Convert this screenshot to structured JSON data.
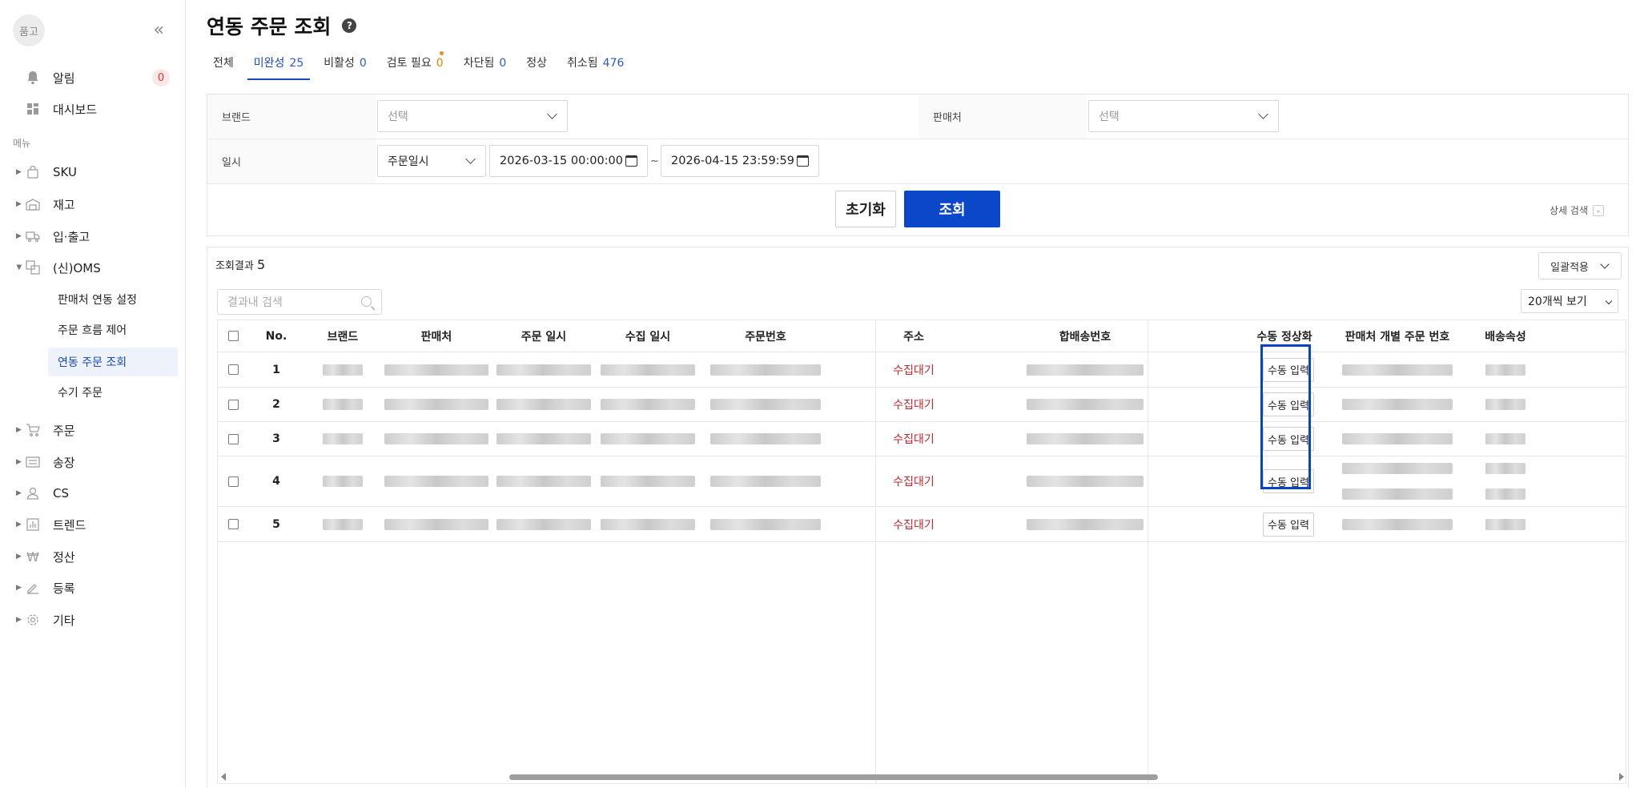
{
  "sidebar": {
    "avatar_text": "품고",
    "menu_label": "메뉴",
    "top_items": [
      {
        "label": "알림",
        "badge": "0"
      },
      {
        "label": "대시보드"
      }
    ],
    "items": [
      {
        "label": "SKU"
      },
      {
        "label": "재고"
      },
      {
        "label": "입·출고"
      },
      {
        "label": "(신)OMS"
      },
      {
        "label": "주문"
      },
      {
        "label": "송장"
      },
      {
        "label": "CS"
      },
      {
        "label": "트렌드"
      },
      {
        "label": "정산"
      },
      {
        "label": "등록"
      },
      {
        "label": "기타"
      }
    ],
    "oms_sub": [
      {
        "label": "판매처 연동 설정"
      },
      {
        "label": "주문 흐름 제어"
      },
      {
        "label": "연동 주문 조회"
      },
      {
        "label": "수기 주문"
      }
    ]
  },
  "page": {
    "title": "연동 주문 조회",
    "help": "?"
  },
  "tabs": [
    {
      "label": "전체",
      "count": ""
    },
    {
      "label": "미완성",
      "count": "25"
    },
    {
      "label": "비활성",
      "count": "0"
    },
    {
      "label": "검토 필요",
      "count": "0"
    },
    {
      "label": "차단됨",
      "count": "0"
    },
    {
      "label": "정상",
      "count": ""
    },
    {
      "label": "취소됨",
      "count": "476"
    }
  ],
  "filter": {
    "brand_label": "브랜드",
    "brand_value": "선택",
    "seller_label": "판매처",
    "seller_value": "선택",
    "date_label": "일시",
    "date_type": "주문일시",
    "date_from": "2026-03-15 00:00:00",
    "date_sep": "~",
    "date_to": "2026-04-15 23:59:59",
    "reset": "초기화",
    "search": "조회",
    "advanced": "상세 검색"
  },
  "results": {
    "title": "조회결과",
    "count": "5",
    "bulk": "일괄적용",
    "search_placeholder": "결과내 검색",
    "page_size": "20개씩 보기",
    "columns": [
      "No.",
      "브랜드",
      "판매처",
      "주문 일시",
      "수집 일시",
      "주문번호",
      "주소",
      "합배송번호",
      "수동 정상화",
      "판매처 개별 주문 번호",
      "배송속성"
    ],
    "rows": [
      {
        "no": "1",
        "address": "수집대기",
        "action": "수동 입력"
      },
      {
        "no": "2",
        "address": "수집대기",
        "action": "수동 입력"
      },
      {
        "no": "3",
        "address": "수집대기",
        "action": "수동 입력"
      },
      {
        "no": "4",
        "address": "수집대기",
        "action": "수동 입력"
      },
      {
        "no": "5",
        "address": "수집대기",
        "action": "수동 입력"
      }
    ]
  },
  "colors": {
    "accent": "#0b47c9",
    "status_red": "#c1272d",
    "highlight": "#0a44c4"
  }
}
